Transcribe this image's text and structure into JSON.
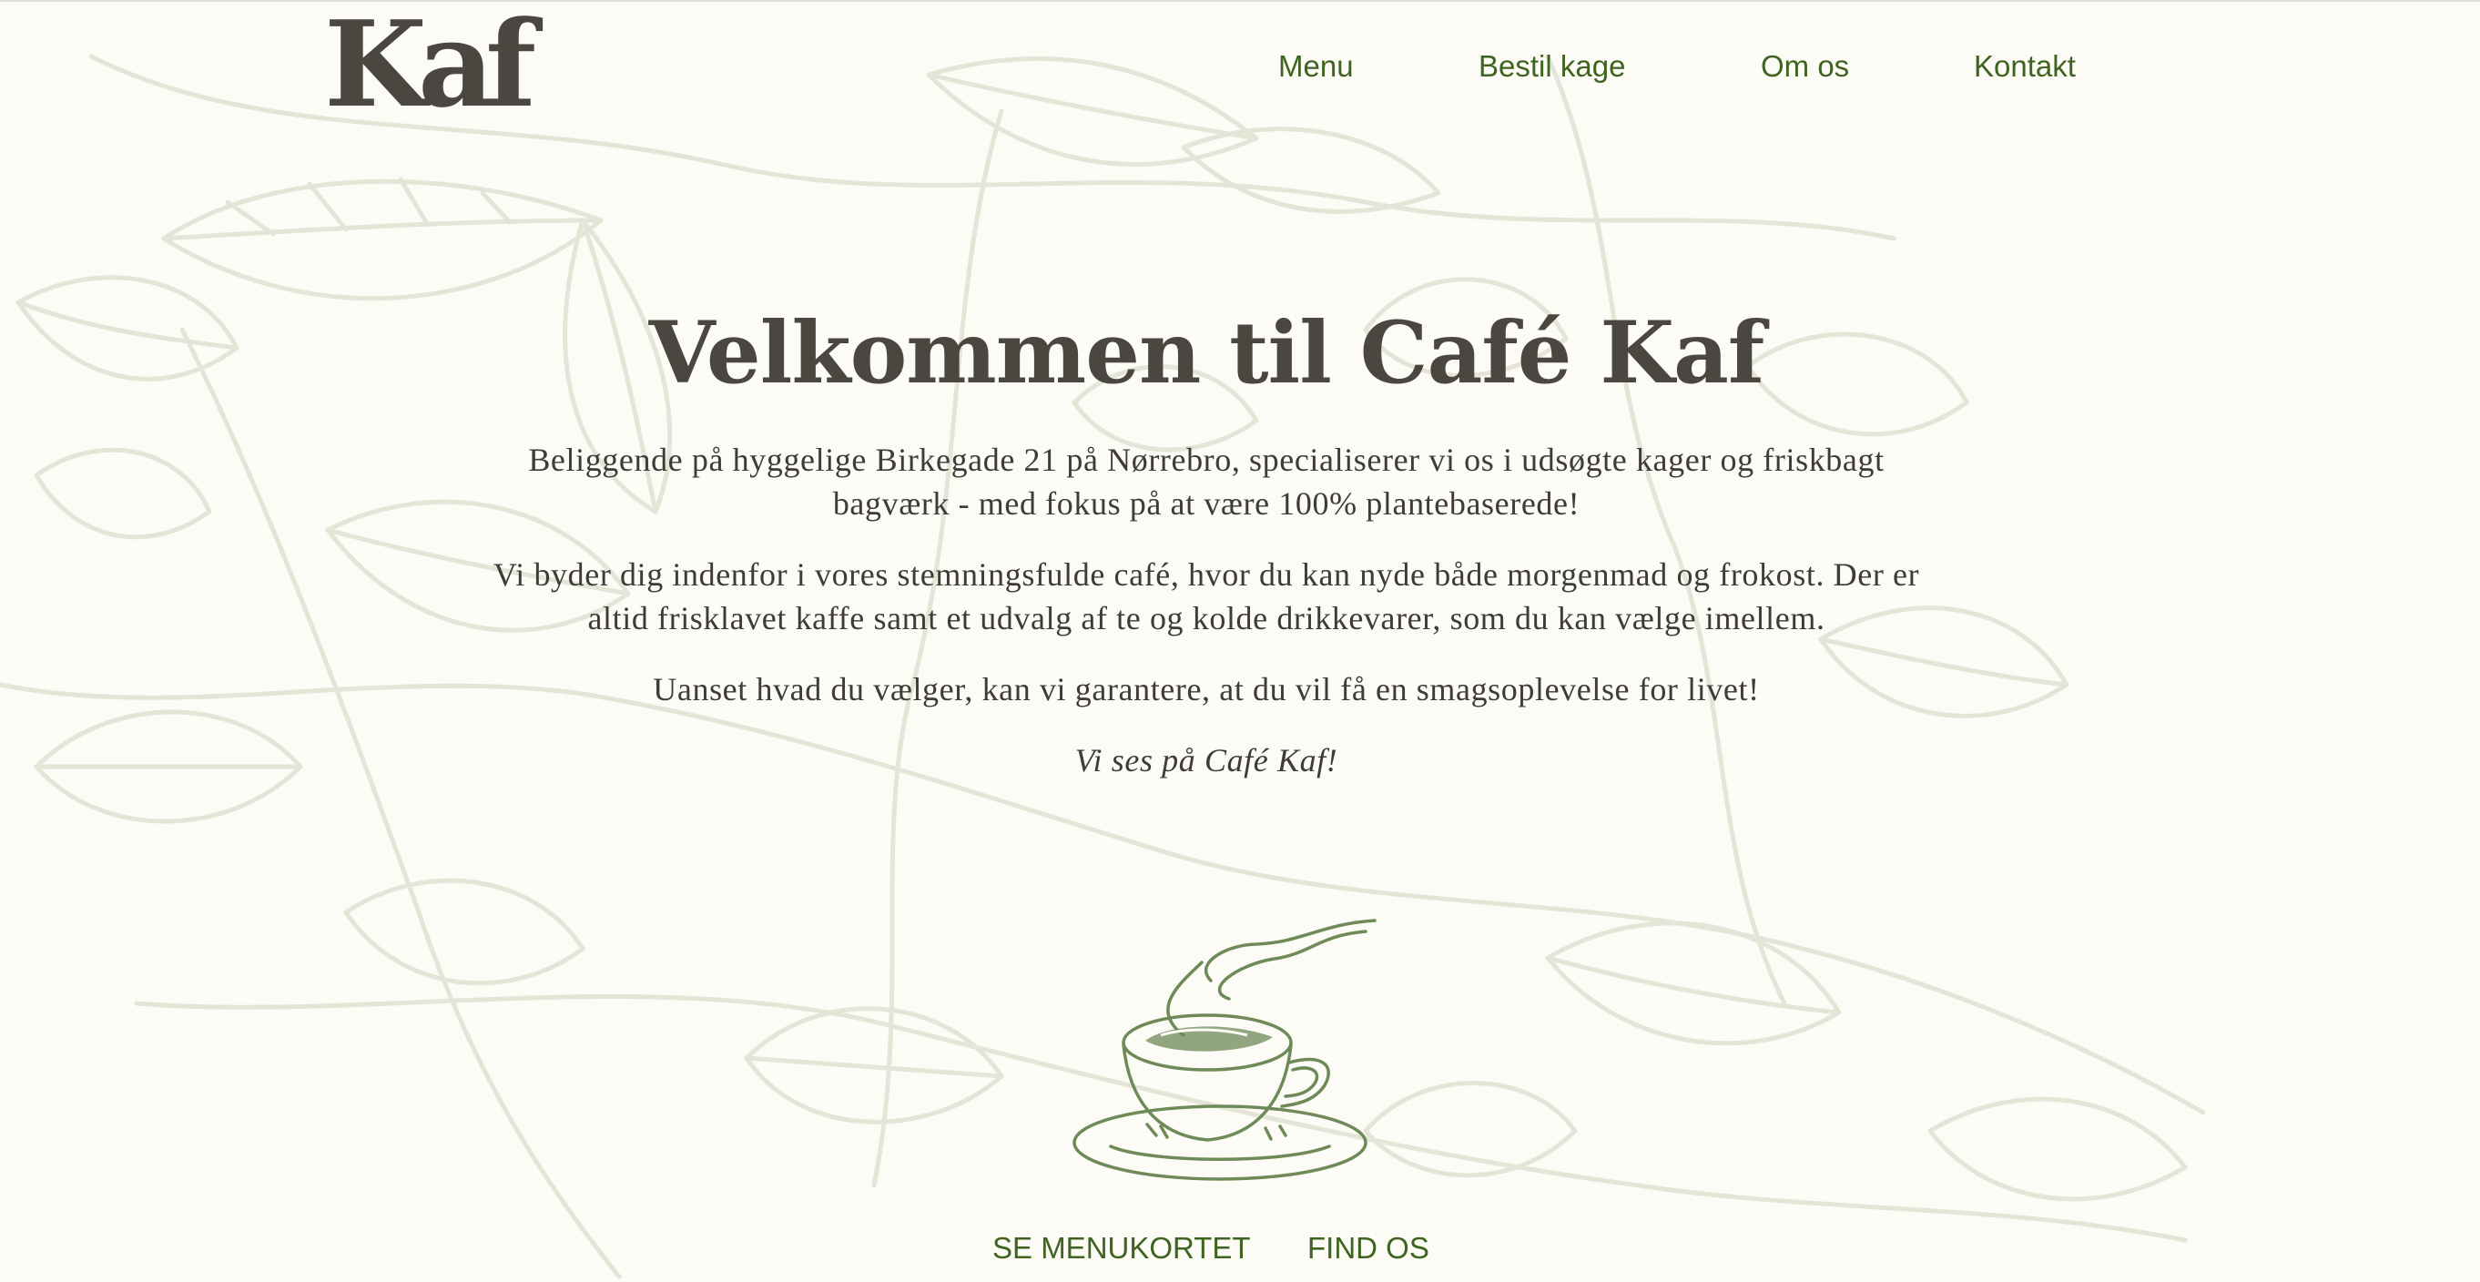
{
  "brand": {
    "logo_text": "Kaf"
  },
  "nav": {
    "items": [
      {
        "label": "Menu"
      },
      {
        "label": "Bestil kage"
      },
      {
        "label": "Om os"
      },
      {
        "label": "Kontakt"
      }
    ]
  },
  "hero": {
    "title": "Velkommen til Café Kaf",
    "paragraphs": [
      "Beliggende på hyggelige Birkegade 21 på Nørrebro, specialiserer vi os i udsøgte kager og friskbagt bagværk - med fokus på at være 100% plantebaserede!",
      "Vi byder dig indenfor i vores stemningsfulde café, hvor du kan nyde både morgenmad og frokost. Der er altid frisklavet kaffe samt et udvalg af te og kolde drikkevarer, som du kan vælge imellem.",
      "Uanset hvad du vælger, kan vi garantere, at du vil få en smagsoplevelse for livet!"
    ],
    "sign_off": "Vi ses på Café Kaf!"
  },
  "illustration": {
    "icon": "coffee-cup-icon"
  },
  "cta": {
    "menu_label": "SE MENUKORTET",
    "find_label": "FIND OS"
  },
  "colors": {
    "background": "#fcfbf6",
    "text_dark": "#4a4640",
    "link_green": "#3f6420",
    "botanical_line": "#e4e5d7",
    "cup_green": "#6e8a58"
  }
}
